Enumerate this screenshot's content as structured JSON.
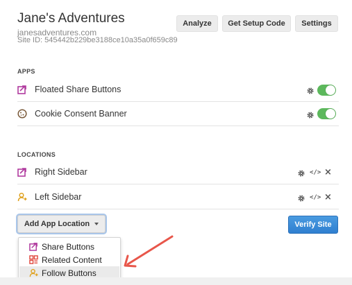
{
  "site": {
    "title": "Jane's Adventures",
    "url": "janesadventures.com",
    "id": "Site ID: 545442b229be3188ce10a35a0f659c89"
  },
  "header_buttons": {
    "analyze": "Analyze",
    "setup": "Get Setup Code",
    "settings": "Settings"
  },
  "apps": {
    "section_label": "APPS",
    "items": [
      {
        "label": "Floated Share Buttons",
        "icon": "share-icon",
        "enabled": true
      },
      {
        "label": "Cookie Consent Banner",
        "icon": "cookie-icon",
        "enabled": true
      }
    ]
  },
  "locations": {
    "section_label": "LOCATIONS",
    "items": [
      {
        "label": "Right Sidebar",
        "icon": "share-icon"
      },
      {
        "label": "Left Sidebar",
        "icon": "follow-icon"
      }
    ]
  },
  "actions": {
    "add_location": "Add App Location",
    "verify": "Verify Site"
  },
  "dropdown": {
    "items": [
      {
        "label": "Share Buttons",
        "icon": "share-icon"
      },
      {
        "label": "Related Content",
        "icon": "related-content-icon"
      },
      {
        "label": "Follow Buttons",
        "icon": "follow-icon",
        "hovered": true
      }
    ]
  },
  "colors": {
    "share_icon": "#b03a9e",
    "follow_icon": "#e0a21e",
    "related_icon": "#e0463b",
    "toggle_on": "#5cb85c",
    "verify_button": "#3a8bd8",
    "annotation_arrow": "#e8564a"
  }
}
